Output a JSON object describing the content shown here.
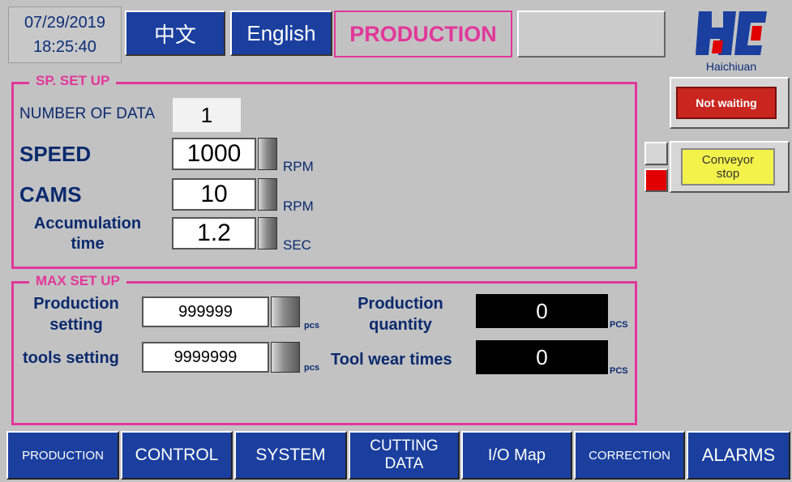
{
  "header": {
    "date": "07/29/2019",
    "time": "18:25:40",
    "lang_zh": "中文",
    "lang_en": "English",
    "screen_title": "PRODUCTION",
    "logo_text": "Haichiuan"
  },
  "sp_setup": {
    "title": "SP. SET UP",
    "number_of_data_label": "NUMBER OF DATA",
    "number_of_data_value": "1",
    "speed_label": "SPEED",
    "speed_value": "1000",
    "speed_unit": "RPM",
    "cams_label": "CAMS",
    "cams_value": "10",
    "cams_unit": "RPM",
    "accum_label_1": "Accumulation",
    "accum_label_2": "time",
    "accum_value": "1.2",
    "accum_unit": "SEC"
  },
  "max_setup": {
    "title": "MAX SET UP",
    "prod_setting_label_1": "Production",
    "prod_setting_label_2": "setting",
    "prod_setting_value": "999999",
    "prod_setting_unit": "pcs",
    "tools_setting_label": "tools setting",
    "tools_setting_value": "9999999",
    "tools_setting_unit": "pcs",
    "prod_qty_label_1": "Production",
    "prod_qty_label_2": "quantity",
    "prod_qty_value": "0",
    "prod_qty_unit": "PCS",
    "tool_wear_label": "Tool wear times",
    "tool_wear_value": "0",
    "tool_wear_unit": "PCS"
  },
  "side": {
    "not_waiting": "Not waiting",
    "conveyor_1": "Conveyor",
    "conveyor_2": "stop"
  },
  "nav": {
    "production": "PRODUCTION",
    "control": "CONTROL",
    "system": "SYSTEM",
    "cutting_1": "CUTTING",
    "cutting_2": "DATA",
    "io_map": "I/O Map",
    "correction": "CORRECTION",
    "alarms": "ALARMS"
  },
  "colors": {
    "accent_pink": "#e2379b",
    "nav_blue": "#1a3f9e",
    "label_navy": "#0a2a6e",
    "alarm_red": "#c8261f",
    "indicator_red": "#e00000",
    "conveyor_yellow": "#f2f24a",
    "background": "#c2c2c2"
  }
}
